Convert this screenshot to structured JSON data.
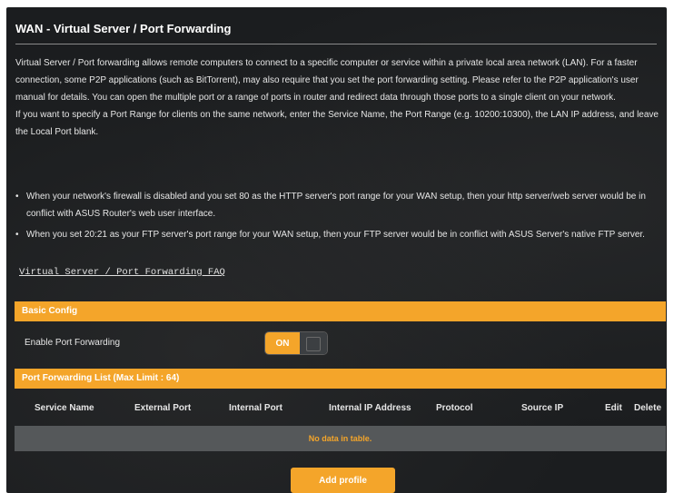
{
  "title": "WAN - Virtual Server / Port Forwarding",
  "description": [
    "Virtual Server / Port forwarding allows remote computers to connect to a specific computer or service within a private local area network (LAN). For a faster connection, some P2P applications (such as BitTorrent), may also require that you set the port forwarding setting. Please refer to the P2P application's user manual for details. You can open the multiple port or a range of ports in router and redirect data through those ports to a single client on your network.",
    "If you want to specify a Port Range for clients on the same network, enter the Service Name, the Port Range (e.g. 10200:10300), the LAN IP address, and leave the Local Port blank."
  ],
  "notes": [
    "When your network's firewall is disabled and you set 80 as the HTTP server's port range for your WAN setup, then your http server/web server would be in conflict with ASUS Router's web user interface.",
    "When you set 20:21 as your FTP server's port range for your WAN setup, then your FTP server would be in conflict with ASUS Server's native FTP server."
  ],
  "bullet_char": "•",
  "faq_link": "Virtual Server / Port Forwarding FAQ",
  "basic_config": {
    "header": "Basic Config",
    "enable_label": "Enable Port Forwarding",
    "toggle_state": "ON"
  },
  "port_list": {
    "header": "Port Forwarding List (Max Limit : 64)",
    "columns": [
      "Service Name",
      "External Port",
      "Internal Port",
      "Internal IP Address",
      "Protocol",
      "Source IP",
      "Edit",
      "Delete"
    ],
    "empty_text": "No data in table."
  },
  "add_button": "Add profile",
  "colors": {
    "accent": "#f4a52a",
    "panel_bg": "#1b1d1f",
    "empty_row_bg": "#55585a"
  }
}
